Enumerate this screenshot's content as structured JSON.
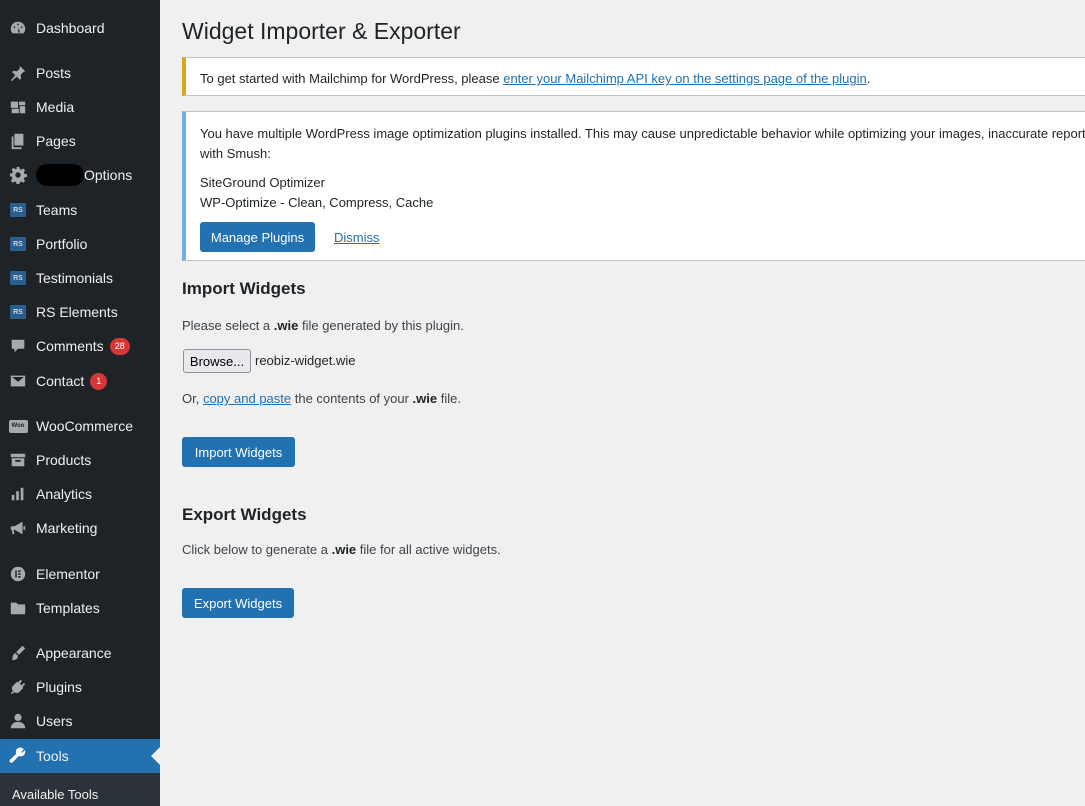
{
  "sidebar": {
    "items": [
      {
        "label": "Dashboard",
        "icon": "dashboard-icon"
      },
      {
        "label": "Posts",
        "icon": "pin-icon"
      },
      {
        "label": "Media",
        "icon": "media-icon"
      },
      {
        "label": "Pages",
        "icon": "pages-icon"
      },
      {
        "label": "Options",
        "icon": "gear-icon"
      },
      {
        "label": "Teams",
        "icon": "rs-icon",
        "icon_text": "RS"
      },
      {
        "label": "Portfolio",
        "icon": "rs-icon",
        "icon_text": "RS"
      },
      {
        "label": "Testimonials",
        "icon": "rs-icon",
        "icon_text": "RS"
      },
      {
        "label": "RS Elements",
        "icon": "rs-icon",
        "icon_text": "RS"
      },
      {
        "label": "Comments",
        "icon": "comment-icon",
        "badge": "28"
      },
      {
        "label": "Contact",
        "icon": "mail-icon",
        "badge": "1"
      },
      {
        "label": "WooCommerce",
        "icon": "woo-icon",
        "icon_text": "Woo"
      },
      {
        "label": "Products",
        "icon": "archive-icon"
      },
      {
        "label": "Analytics",
        "icon": "bar-chart-icon"
      },
      {
        "label": "Marketing",
        "icon": "megaphone-icon"
      },
      {
        "label": "Elementor",
        "icon": "elementor-icon"
      },
      {
        "label": "Templates",
        "icon": "folder-icon"
      },
      {
        "label": "Appearance",
        "icon": "brush-icon"
      },
      {
        "label": "Plugins",
        "icon": "plug-icon"
      },
      {
        "label": "Users",
        "icon": "user-icon"
      },
      {
        "label": "Tools",
        "icon": "wrench-icon",
        "active": true
      }
    ],
    "submenu": {
      "label": "Available Tools"
    }
  },
  "page": {
    "title": "Widget Importer & Exporter"
  },
  "notices": {
    "mailchimp": {
      "text": "To get started with Mailchimp for WordPress, please ",
      "link": "enter your Mailchimp API key on the settings page of the plugin",
      "suffix": "."
    },
    "smush": {
      "line1": "You have multiple WordPress image optimization plugins installed. This may cause unpredictable behavior while optimizing your images, inaccurate reports",
      "line2": "with Smush:",
      "plugins": [
        "SiteGround Optimizer",
        "WP-Optimize - Clean, Compress, Cache"
      ],
      "manage_label": "Manage Plugins",
      "dismiss_label": "Dismiss"
    }
  },
  "import": {
    "heading": "Import Widgets",
    "instruction_pre": "Please select a ",
    "instruction_bold": ".wie",
    "instruction_post": " file generated by this plugin.",
    "browse_label": "Browse...",
    "filename": "reobiz-widget.wie",
    "alt_pre": "Or, ",
    "alt_link": "copy and paste",
    "alt_mid": " the contents of your ",
    "alt_bold": ".wie",
    "alt_post": " file.",
    "button_label": "Import Widgets"
  },
  "export": {
    "heading": "Export Widgets",
    "instruction_pre": "Click below to generate a ",
    "instruction_bold": ".wie",
    "instruction_post": " file for all active widgets.",
    "button_label": "Export Widgets"
  },
  "colors": {
    "sidebar_bg": "#1d2327",
    "accent": "#2271b1",
    "warning_border": "#dba617",
    "info_border": "#72aee6",
    "badge": "#d63638"
  }
}
